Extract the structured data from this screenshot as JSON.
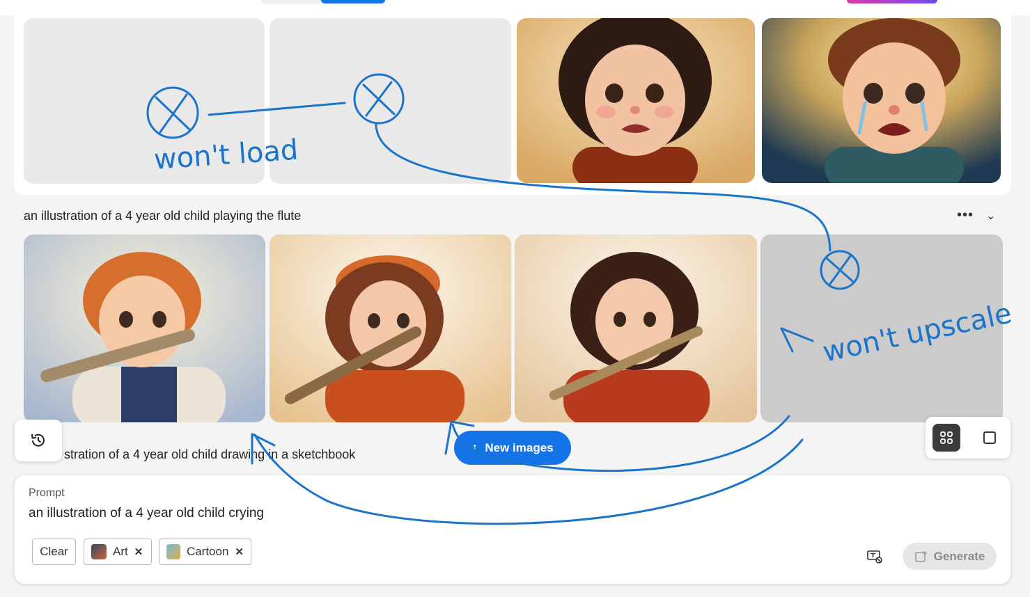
{
  "row_one": {
    "images": [
      {
        "status": "empty"
      },
      {
        "status": "empty"
      },
      {
        "status": "image",
        "subject": "girl crying"
      },
      {
        "status": "image",
        "subject": "boy crying"
      }
    ]
  },
  "row_two": {
    "title": "an illustration of a 4 year old child playing the flute",
    "more_icon": "more-dots-icon",
    "collapse_icon": "chevron-down-icon",
    "images": [
      {
        "status": "image",
        "subject": "boy playing flute"
      },
      {
        "status": "image",
        "subject": "girl in hat playing flute"
      },
      {
        "status": "image",
        "subject": "girl playing flute"
      },
      {
        "status": "empty"
      }
    ]
  },
  "row_three": {
    "title": "an illustration of a 4 year old child drawing in a sketchbook",
    "visible_title": "stration of a 4 year old child drawing in a sketchbook"
  },
  "history": {
    "icon": "history-icon"
  },
  "new_images": {
    "label": "New images",
    "icon": "arrow-up-icon"
  },
  "view_toggle": {
    "grid_icon": "grid-view-icon",
    "single_icon": "single-view-icon",
    "active": "grid"
  },
  "prompt": {
    "label": "Prompt",
    "value": "an illustration of a 4 year old child crying",
    "clear_label": "Clear",
    "chips": [
      {
        "label": "Art",
        "icon": "art-style-thumbnail"
      },
      {
        "label": "Cartoon",
        "icon": "cartoon-style-thumbnail"
      }
    ],
    "text_settings_icon": "text-settings-icon",
    "generate_label": "Generate",
    "generate_icon": "generate-sparkle-icon"
  },
  "annotations": {
    "wont_load": "won't load",
    "wont_upscale": "won't upscale"
  },
  "colors": {
    "accent": "#1473e6",
    "annotation_ink": "#1a74c9",
    "disabled_bg": "#e6e6e6"
  }
}
